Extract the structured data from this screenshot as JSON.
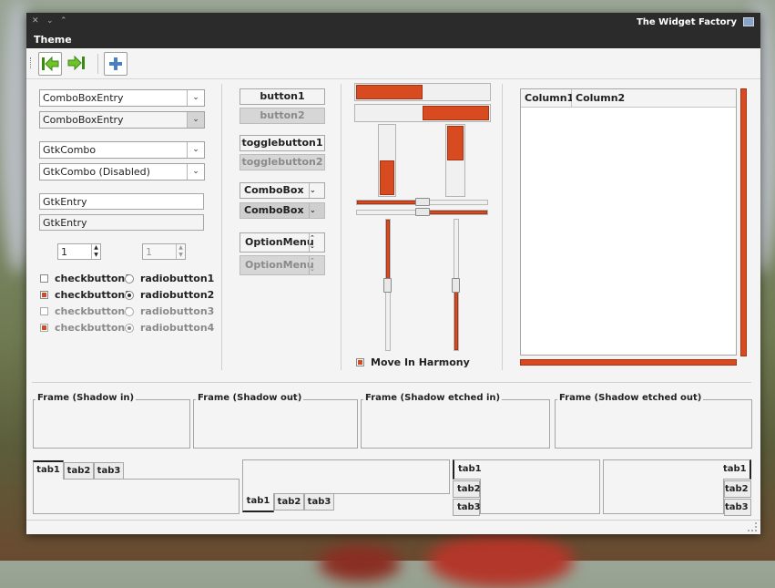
{
  "window": {
    "title": "The Widget Factory",
    "menu": "Theme",
    "accent": "#d84a20"
  },
  "toolbar": {
    "back_icon": "go-first-icon",
    "forward_icon": "go-last-icon",
    "add_icon": "add-icon"
  },
  "col1": {
    "combo_entry_1": "ComboBoxEntry",
    "combo_entry_2": "ComboBoxEntry",
    "gtk_combo_1": "GtkCombo",
    "gtk_combo_2": "GtkCombo (Disabled)",
    "entry_1": "GtkEntry",
    "entry_2": "GtkEntry",
    "spin_1": "1",
    "spin_2": "1",
    "checks": [
      "checkbutton1",
      "checkbutton2",
      "checkbutton3",
      "checkbutton4"
    ],
    "radios": [
      "radiobutton1",
      "radiobutton2",
      "radiobutton3",
      "radiobutton4"
    ]
  },
  "col2": {
    "button1": "button1",
    "button2": "button2",
    "toggle1": "togglebutton1",
    "toggle2": "togglebutton2",
    "combo1": "ComboBox",
    "combo2": "ComboBox",
    "option1": "OptionMenu",
    "option2": "OptionMenu"
  },
  "col3": {
    "hprogress_1": 0.5,
    "hprogress_2": 0.5,
    "vprogress_1": 0.5,
    "vprogress_2": 0.5,
    "hscale_1": 0.5,
    "hscale_2": 0.5,
    "vscale_1": 0.5,
    "vscale_2": 0.5,
    "move_in_harmony": "Move In Harmony"
  },
  "tree": {
    "columns": [
      "Column1",
      "Column2"
    ]
  },
  "frames": [
    "Frame (Shadow in)",
    "Frame (Shadow out)",
    "Frame (Shadow etched in)",
    "Frame (Shadow etched out)"
  ],
  "tabs": [
    "tab1",
    "tab2",
    "tab3"
  ]
}
